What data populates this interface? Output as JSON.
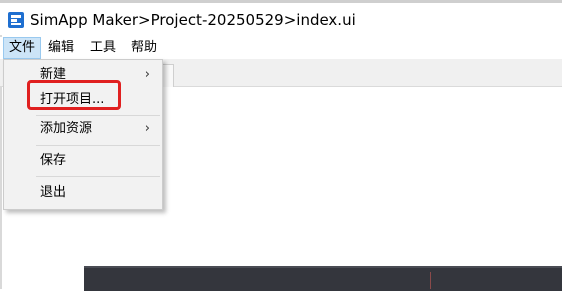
{
  "window": {
    "title": "SimApp Maker>Project-20250529>index.ui"
  },
  "menubar": {
    "items": [
      {
        "label": "文件",
        "active": true
      },
      {
        "label": "编辑",
        "active": false
      },
      {
        "label": "工具",
        "active": false
      },
      {
        "label": "帮助",
        "active": false
      }
    ]
  },
  "file_menu": {
    "items": [
      {
        "label": "新建",
        "submenu": true
      },
      {
        "label": "打开项目...",
        "submenu": false,
        "highlighted": true
      },
      {
        "label": "添加资源",
        "submenu": true
      },
      {
        "label": "保存",
        "submenu": false
      },
      {
        "label": "退出",
        "submenu": false
      }
    ],
    "submenu_arrow": "›"
  },
  "colors": {
    "menu_active_bg": "#cce4f7",
    "highlight_border": "#e02020",
    "app_icon": "#1f6fd0",
    "dark_panel": "#34363d"
  },
  "icons": {
    "app": "simapp-logo-icon",
    "submenu": "chevron-right-icon"
  }
}
